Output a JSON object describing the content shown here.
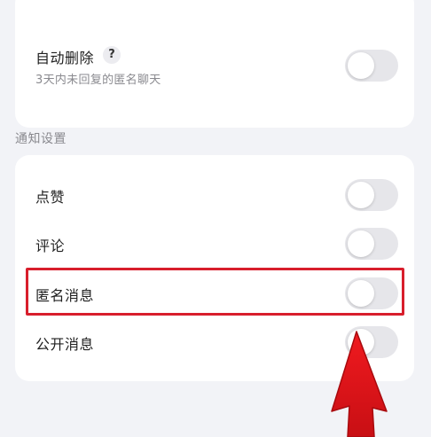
{
  "auto_delete": {
    "title": "自动删除",
    "help_symbol": "?",
    "subtitle": "3天内未回复的匿名聊天",
    "enabled": false
  },
  "notification_section": {
    "heading": "通知设置",
    "items": [
      {
        "label": "点赞",
        "enabled": false
      },
      {
        "label": "评论",
        "enabled": false
      },
      {
        "label": "匿名消息",
        "enabled": false
      },
      {
        "label": "公开消息",
        "enabled": false
      }
    ]
  },
  "annotation": {
    "highlight_color": "#d81e2c",
    "arrow_color": "#e3161b"
  }
}
